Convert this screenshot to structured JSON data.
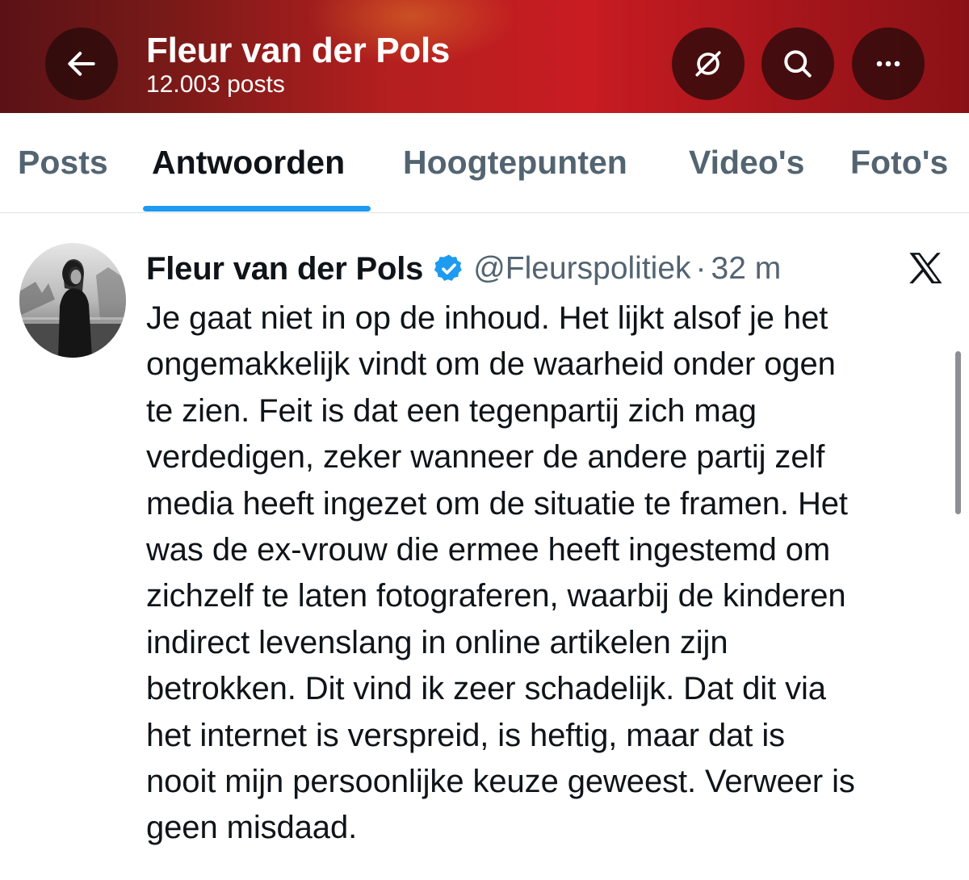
{
  "header": {
    "title": "Fleur van der Pols",
    "subtitle": "12.003 posts",
    "back_icon": "arrow-left-icon",
    "notifications_icon": "bell-slash-icon",
    "search_icon": "search-icon",
    "more_icon": "more-horizontal-icon"
  },
  "tabs": [
    {
      "label": "Posts",
      "active": false
    },
    {
      "label": "Antwoorden",
      "active": true
    },
    {
      "label": "Hoogtepunten",
      "active": false
    },
    {
      "label": "Video's",
      "active": false
    },
    {
      "label": "Foto's",
      "active": false
    }
  ],
  "post": {
    "author": "Fleur van der Pols",
    "handle": "@Fleurspolitiek",
    "separator": "·",
    "time": "32 m",
    "verified": true,
    "lines": [
      "Je gaat niet in op de inhoud. Het lijkt alsof je het",
      "ongemakkelijk vindt om de waarheid onder ogen",
      "te zien. Feit is dat een tegenpartij zich mag",
      "verdedigen, zeker wanneer de andere partij zelf",
      "media heeft ingezet om de situatie te framen. Het",
      "was de ex-vrouw die ermee heeft ingestemd om",
      "zichzelf te laten fotograferen, waarbij de kinderen",
      "indirect levenslang in online artikelen zijn",
      "betrokken. Dit vind ik zeer schadelijk. Dat dit via",
      "het internet is verspreid, is heftig, maar dat is",
      "nooit mijn persoonlijke keuze geweest. Verweer is",
      "geen misdaad."
    ]
  },
  "colors": {
    "accent": "#1d9bf0",
    "header_red": "#c81c22",
    "text_primary": "#0f1419",
    "text_secondary": "#536471"
  }
}
